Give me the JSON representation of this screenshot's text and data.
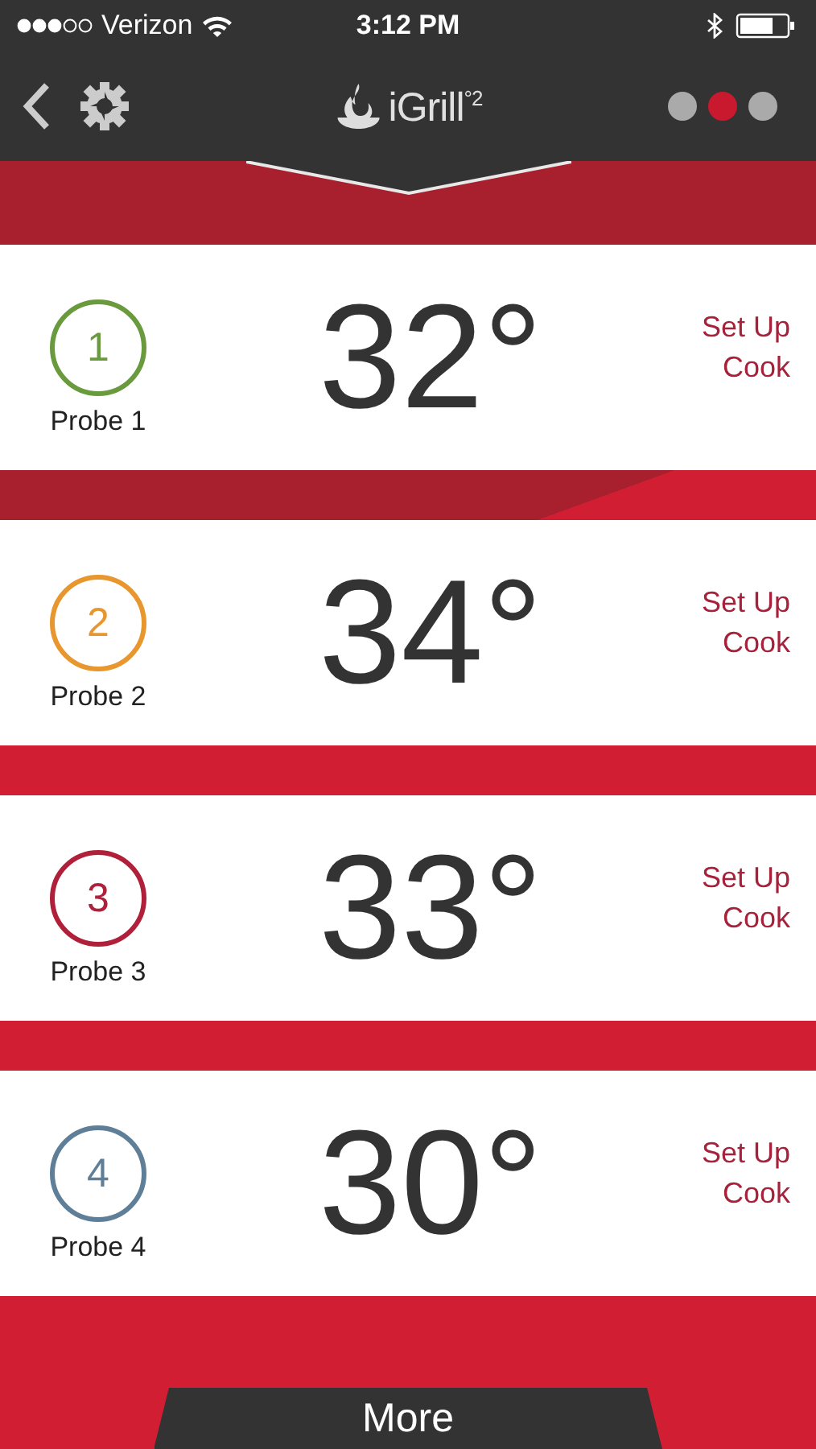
{
  "status_bar": {
    "carrier": "Verizon",
    "time": "3:12 PM"
  },
  "header": {
    "title": "iGrill$^{°2}$",
    "pages": [
      {
        "selected": false
      },
      {
        "selected": true
      },
      {
        "selected": false
      }
    ]
  },
  "probes": [
    {
      "number": "1",
      "label": "Probe 1",
      "temperature": "32°",
      "action": "Set Up Cook",
      "color": "#6a9a3e"
    },
    {
      "number": "2",
      "label": "Probe 2",
      "temperature": "34°",
      "action": "Set Up Cook",
      "color": "#e8962e"
    },
    {
      "number": "3",
      "label": "Probe 3",
      "temperature": "33°",
      "action": "Set Up Cook",
      "color": "#b0203a"
    },
    {
      "number": "4",
      "label": "Probe 4",
      "temperature": "30°",
      "action": "Set Up Cook",
      "color": "#5f7f99"
    }
  ],
  "more_button": "More"
}
